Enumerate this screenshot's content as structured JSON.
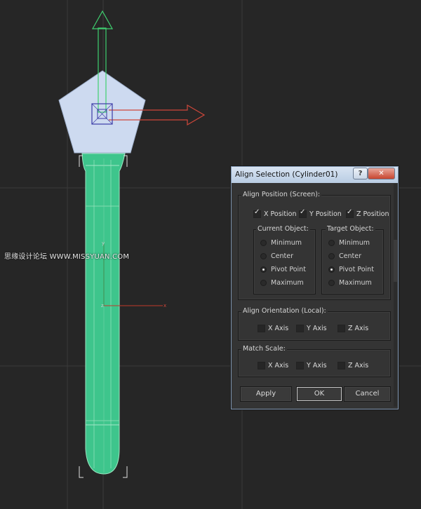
{
  "watermark": "思缘设计论坛 WWW.MISSYUAN.COM",
  "viewport_axes": {
    "y": "y",
    "z": "z",
    "x": "x"
  },
  "dialog": {
    "title": "Align Selection (Cylinder01)",
    "help_label": "?",
    "close_label": "✕",
    "align_position": {
      "label": "Align Position (Screen):",
      "x_label": "X Position",
      "x_checked": true,
      "y_label": "Y Position",
      "y_checked": true,
      "z_label": "Z Position",
      "z_checked": true
    },
    "current_object": {
      "label": "Current Object:",
      "options": [
        "Minimum",
        "Center",
        "Pivot Point",
        "Maximum"
      ],
      "selected": "Pivot Point"
    },
    "target_object": {
      "label": "Target Object:",
      "options": [
        "Minimum",
        "Center",
        "Pivot Point",
        "Maximum"
      ],
      "selected": "Pivot Point"
    },
    "align_orientation": {
      "label": "Align Orientation (Local):",
      "x_label": "X Axis",
      "y_label": "Y Axis",
      "z_label": "Z Axis"
    },
    "match_scale": {
      "label": "Match Scale:",
      "x_label": "X Axis",
      "y_label": "Y Axis",
      "z_label": "Z Axis"
    },
    "buttons": {
      "apply": "Apply",
      "ok": "OK",
      "cancel": "Cancel"
    }
  },
  "colors": {
    "viewport_bg": "#262626",
    "mesh": "#3ec58c",
    "gizmo_fill": "#cddaf0",
    "y_axis": "#3fcf6f",
    "x_axis": "#d0473a"
  }
}
